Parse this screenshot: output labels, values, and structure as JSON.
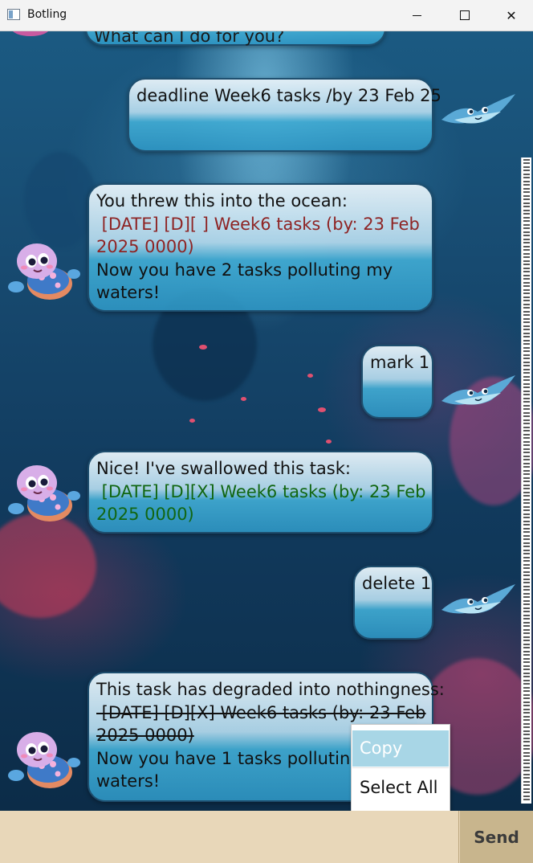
{
  "window": {
    "title": "Botling",
    "minimize_label": "—",
    "close_label": "✕"
  },
  "chat": {
    "partial_top": "What can I do for you?",
    "messages": [
      {
        "sender": "user",
        "lines": [
          "deadline Week6 tasks /by 23 Feb 25"
        ]
      },
      {
        "sender": "bot",
        "lines": [
          "You threw this into the ocean:",
          " [DATE] [D][ ] Week6 tasks (by: 23 Feb",
          "2025 0000)",
          "Now you have 2 tasks polluting my",
          "waters!"
        ]
      },
      {
        "sender": "user",
        "lines": [
          "mark 1"
        ]
      },
      {
        "sender": "bot",
        "lines": [
          "Nice! I've swallowed this task:",
          " [DATE] [D][X] Week6 tasks (by: 23 Feb",
          "2025 0000)"
        ]
      },
      {
        "sender": "user",
        "lines": [
          "delete 1"
        ]
      },
      {
        "sender": "bot",
        "lines": [
          "This task has degraded into nothingness:",
          " [DATE] [D][X] Week6 tasks (by: 23 Feb",
          "2025 0000)",
          "Now you have 1 tasks polluting",
          "waters!"
        ]
      }
    ]
  },
  "context_menu": {
    "items": [
      "Copy",
      "Select All"
    ],
    "highlighted": "Copy"
  },
  "input": {
    "value": "",
    "placeholder": ""
  },
  "send_button": {
    "label": "Send"
  },
  "colors": {
    "added_task": "#8e2424",
    "done_task": "#116611",
    "input_bar": "#e8d7b9",
    "send_button": "#c8b58d",
    "menu_highlight": "#a8d6e6"
  },
  "icons": {
    "bot_avatar": "sea-turtle-icon",
    "user_avatar": "manta-ray-icon",
    "app_icon": "window-app-icon"
  }
}
